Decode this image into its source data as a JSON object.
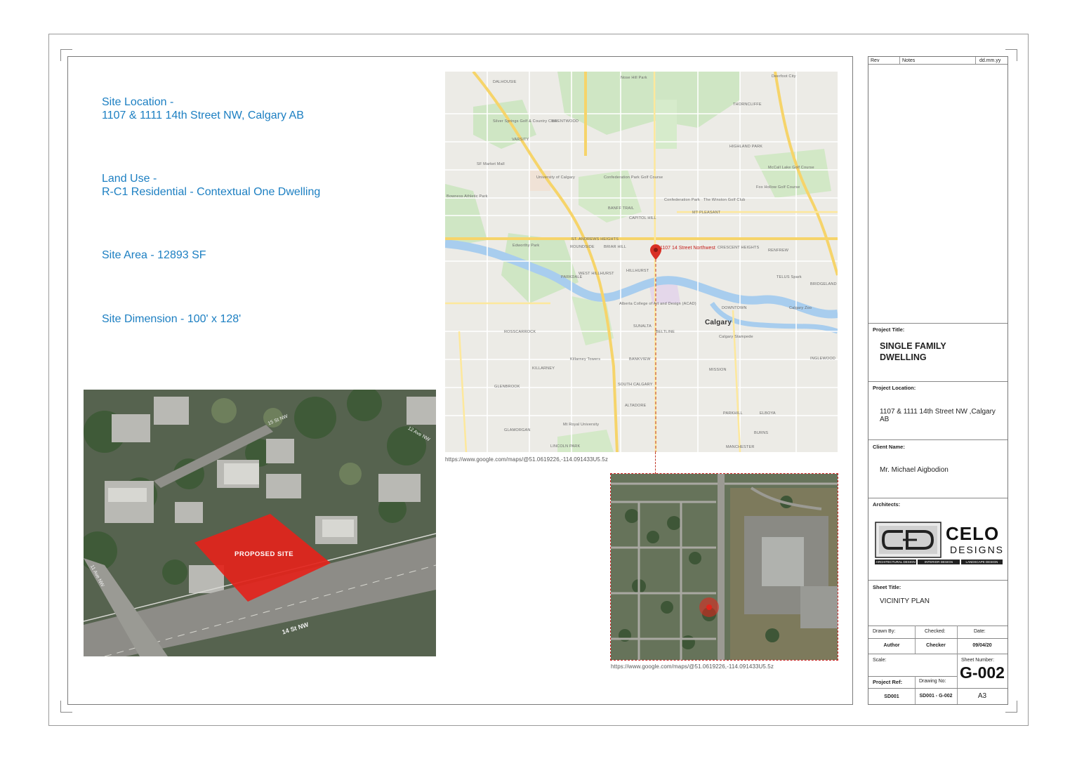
{
  "site_info": {
    "location_label": "Site Location -",
    "location_value": "1107 & 1111 14th Street NW, Calgary AB",
    "land_use_label": "Land Use -",
    "land_use_value": "R-C1 Residential - Contextual One Dwelling",
    "site_area": "Site Area - 12893 SF",
    "site_dimension": "Site Dimension - 100' x 128'"
  },
  "city_map": {
    "pin_label": "1107 14 Street Northwest",
    "places": [
      "Nose Hill Park",
      "DALHOUSIE",
      "Deerfoot City",
      "Silver Springs Golf & Country Club",
      "BRENTWOOD",
      "THORNCLIFFE",
      "VARSITY",
      "HIGHLAND PARK",
      "SF Market Mall",
      "University of Calgary",
      "Confederation Park Golf Course",
      "McCall Lake Golf Course",
      "Fox Hollow Golf Course",
      "Confederation Park",
      "Bowness Athletic Park",
      "BANFF TRAIL",
      "The Winston Golf Club",
      "CAPITOL HILL",
      "MT PLEASANT",
      "ST. ANDREWS HEIGHTS",
      "ROUNDSIDE",
      "BRIAR HILL",
      "CRESCENT HEIGHTS",
      "RENFREW",
      "Edworthy Park",
      "PARKDALE",
      "WEST HILLHURST",
      "HILLHURST",
      "TELUS Spark",
      "Alberta College of Art and Design (ACAD)",
      "SUNALTA",
      "Calgary",
      "DOWNTOWN",
      "Calgary Zoo",
      "BANKVIEW",
      "BELTLINE",
      "ROSSCARROCK",
      "Calgary Stampede",
      "Killarney Towers",
      "KILLARNEY",
      "SOUTH CALGARY",
      "MISSION",
      "GLENBROOK",
      "ALTADORE",
      "Mt Royal University",
      "GLAMORGAN",
      "LINCOLN PARK",
      "PARKHILL",
      "ELBOYA",
      "BURNS",
      "MANCHESTER",
      "INGLEWOOD",
      "BRIDGELAND"
    ]
  },
  "aerial_3d": {
    "proposed_site_label": "PROPOSED SITE",
    "street_labels": [
      "14 St NW",
      "11 Ave NW",
      "15 St NW",
      "12 Ave NW"
    ]
  },
  "map_urls": {
    "city": "https://www.google.com/maps/@51.0619226,-114.091433U5.5z",
    "aerial": "https://www.google.com/maps/@51.0619226,-114.091433U5.5z"
  },
  "title_block": {
    "rev_header": "Rev",
    "notes_header": "Notes",
    "date_header": "dd.mm.yy",
    "project_title_label": "Project Title:",
    "project_title_line1": "SINGLE FAMILY",
    "project_title_line2": "DWELLING",
    "project_location_label": "Project Location:",
    "project_location_value": "1107 & 1111 14th Street NW ,Calgary AB",
    "client_name_label": "Client Name:",
    "client_name_value": "Mr. Michael Aigbodion",
    "architects_label": "Architects:",
    "logo_name_1": "CELO",
    "logo_name_2": "DESIGNS",
    "logo_tagline": [
      "ARCHITECTURAL DESIGN",
      "INTERIOR DESIGN",
      "LANDSCAPE DESIGN"
    ],
    "sheet_title_label": "Sheet Title:",
    "sheet_title_value": "VICINITY PLAN",
    "drawn_by_label": "Drawn By:",
    "checked_label": "Checked:",
    "date_label": "Date:",
    "drawn_by_value": "Author",
    "checked_value": "Checker",
    "date_value": "09/04/20",
    "scale_label": "Scale:",
    "sheet_number_label": "Sheet Number:",
    "sheet_number_value": "G-002",
    "project_ref_label": "Project Ref:",
    "drawing_no_label": "Drawing No:",
    "project_ref_value": "SD001",
    "drawing_no_value": "SD001 - G-002",
    "paper_size": "A3"
  },
  "colors": {
    "info_text": "#1c7fc2",
    "site_highlight": "#e3231b",
    "pin": "#d93025"
  }
}
